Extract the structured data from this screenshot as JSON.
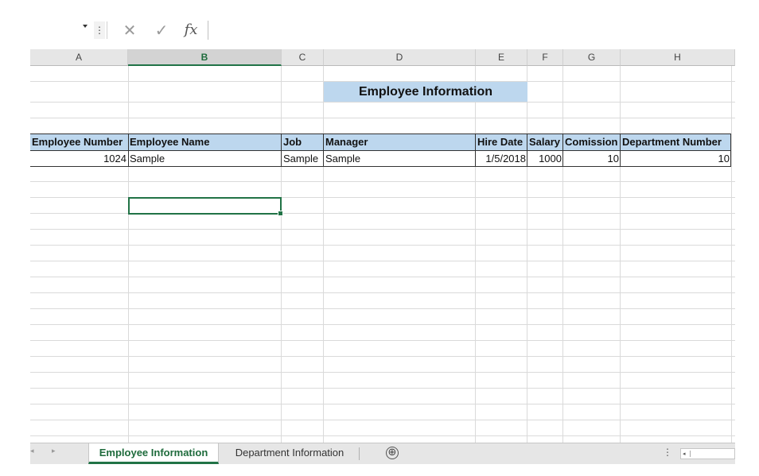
{
  "formula_bar": {
    "name_box_dropdown": "chevron-down-icon",
    "more_icon": "⋮",
    "cancel_icon": "✕",
    "enter_icon": "✓",
    "function_label": "fx"
  },
  "columns": [
    "A",
    "B",
    "C",
    "D",
    "E",
    "F",
    "G",
    "H"
  ],
  "active_column": "B",
  "sheet": {
    "title": "Employee Information",
    "headers": [
      "Employee Number",
      "Employee Name",
      "Job",
      "Manager",
      "Hire Date",
      "Salary",
      "Comission",
      "Department Number"
    ],
    "row": [
      "1024",
      "Sample",
      "Sample",
      "Sample",
      "1/5/2018",
      "1000",
      "10",
      "10"
    ]
  },
  "tabs": {
    "active": "Employee Information",
    "other": "Department Information",
    "add_icon": "⊕",
    "prev_icon": "◂",
    "next_icon": "▸"
  },
  "colors": {
    "accent": "#217346",
    "header_fill": "#bdd7ee"
  }
}
